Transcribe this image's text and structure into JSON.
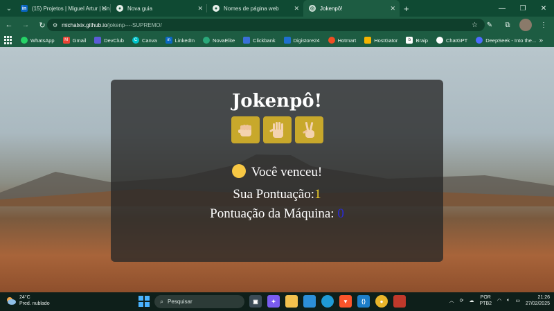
{
  "browser": {
    "tabs": [
      {
        "label": "(15) Projetos | Miguel Artur | Lin",
        "favicon": "linkedin-icon",
        "active": false
      },
      {
        "label": "Nova guia",
        "favicon": "chrome-icon",
        "active": false
      },
      {
        "label": "Nomes de página web",
        "favicon": "chrome-icon",
        "active": false
      },
      {
        "label": "Jokenpô!",
        "favicon": "globe-icon",
        "active": true
      }
    ],
    "address": {
      "host": "michalxix.github.io",
      "path": "/jokenp----SUPREMO/"
    },
    "bookmarks": [
      {
        "label": "WhatsApp",
        "icon": "whatsapp-icon",
        "color": "#25d366"
      },
      {
        "label": "Gmail",
        "icon": "gmail-icon",
        "color": "#ea4335"
      },
      {
        "label": "DevClub",
        "icon": "devclub-icon",
        "color": "#5b5bd6"
      },
      {
        "label": "Canva",
        "icon": "canva-icon",
        "color": "#00c4cc"
      },
      {
        "label": "LinkedIn",
        "icon": "linkedin-icon",
        "color": "#0a66c2"
      },
      {
        "label": "NovaElite",
        "icon": "novaelite-icon",
        "color": "#2aa87a"
      },
      {
        "label": "Clickbank",
        "icon": "clickbank-icon",
        "color": "#3a6fd8"
      },
      {
        "label": "Digistore24",
        "icon": "digistore-icon",
        "color": "#1f6fd0"
      },
      {
        "label": "Hotmart",
        "icon": "hotmart-icon",
        "color": "#f04e23"
      },
      {
        "label": "HostGator",
        "icon": "hostgator-icon",
        "color": "#f5b400"
      },
      {
        "label": "Braip",
        "icon": "braip-icon",
        "color": "#ffffff"
      },
      {
        "label": "ChatGPT",
        "icon": "chatgpt-icon",
        "color": "#ffffff"
      },
      {
        "label": "DeepSeek - Into the...",
        "icon": "deepseek-icon",
        "color": "#4d6bfe"
      }
    ]
  },
  "game": {
    "title": "Jokenpô!",
    "choices": [
      "rock",
      "paper",
      "scissors"
    ],
    "result_text": "Você venceu!",
    "user_score_label": "Sua Pontuação:",
    "user_score": "1",
    "cpu_score_label": "Pontuação da Máquina: ",
    "cpu_score": "0",
    "colors": {
      "button": "#c8a82b",
      "user_score": "#f2d12a",
      "cpu_score": "#2a2ad8"
    }
  },
  "taskbar": {
    "weather_temp": "24°C",
    "weather_desc": "Pred. nublado",
    "search_placeholder": "Pesquisar",
    "lang_top": "POR",
    "lang_bottom": "PTB2",
    "time": "21:26",
    "date": "27/02/2025"
  }
}
